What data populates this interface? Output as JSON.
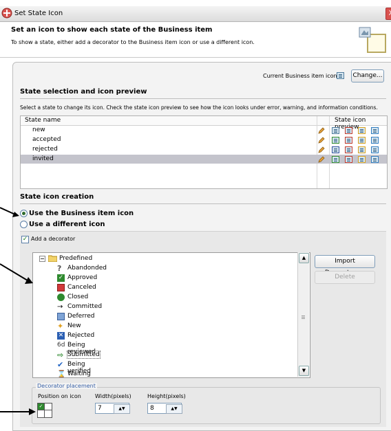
{
  "window": {
    "title": "Set State Icon",
    "close_label": "X"
  },
  "header": {
    "title": "Set an icon to show each state of the Business item",
    "subtitle": "To show a state, either add a decorator to the Business item icon or use a different icon."
  },
  "current_icon": {
    "label": "Current Business item icon",
    "change_button": "Change..."
  },
  "selection": {
    "title": "State selection and icon preview",
    "description": "Select a state to change its icon. Check the state icon preview to see how the icon looks under error, warning, and information conditions.",
    "col_name": "State name",
    "col_preview": "State icon preview",
    "rows": [
      "new",
      "accepted",
      "rejected",
      "invited"
    ],
    "selected_row": "invited"
  },
  "creation": {
    "title": "State icon creation",
    "option_business": "Use the Business item icon",
    "option_different": "Use a different icon",
    "selected_option": "Use the Business item icon",
    "add_decorator_label": "Add a decorator",
    "add_decorator_checked": true
  },
  "tree": {
    "root": "Predefined",
    "items": [
      "Abandonded",
      "Approved",
      "Canceled",
      "Closed",
      "Committed",
      "Deferred",
      "New",
      "Rejected",
      "Being reviewed",
      "Submitted",
      "Being verified",
      "Waiting"
    ],
    "selected_item": "Submitted",
    "scroll_up": "▲",
    "scroll_down": "▼"
  },
  "buttons": {
    "import": "Import Decorators...",
    "delete": "Delete"
  },
  "placement": {
    "group_label": "Decorator placement",
    "position_label": "Position on icon",
    "width_label": "Width(pixels)",
    "height_label": "Height(pixels)",
    "width_value": "7",
    "height_value": "8"
  }
}
